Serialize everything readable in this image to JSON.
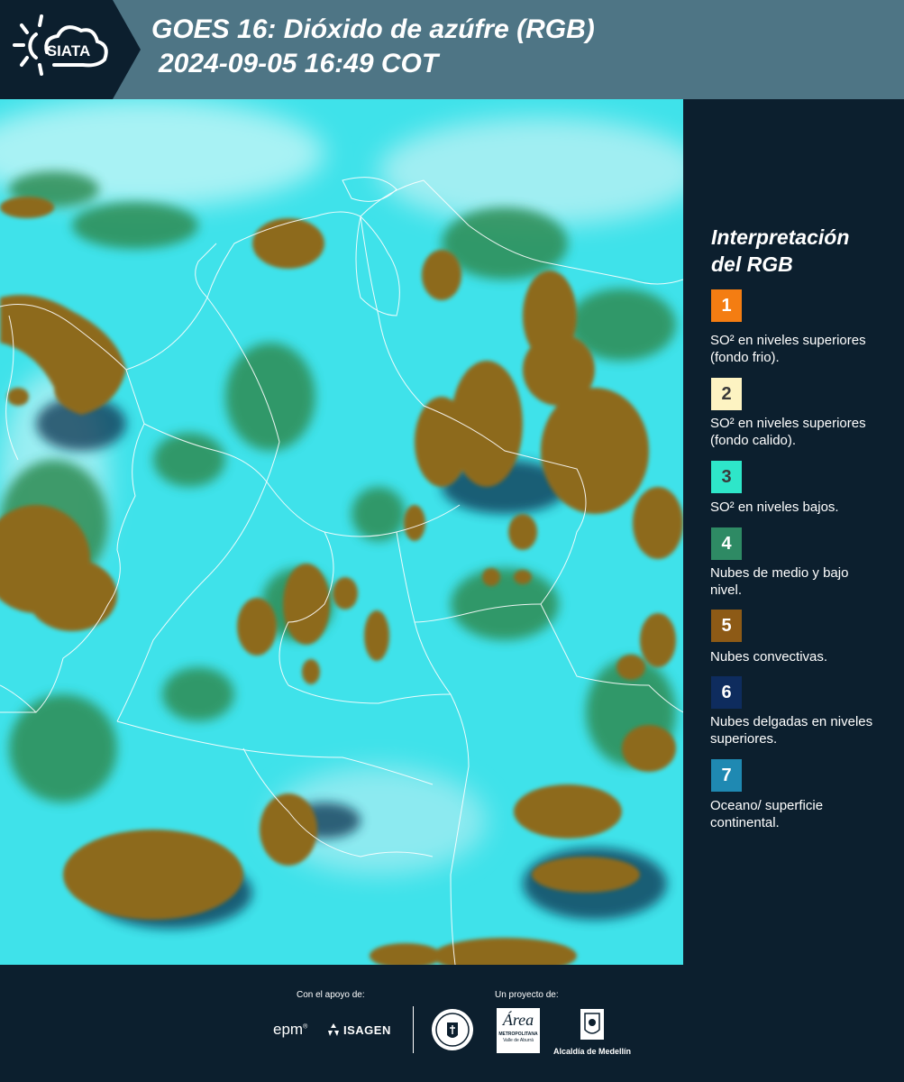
{
  "header": {
    "logo_text": "SIATA",
    "title_line1": "GOES 16: Dióxido de azúfre (RGB)",
    "title_line2": "2024-09-05 16:49 COT"
  },
  "legend": {
    "title_line1": "Interpretación",
    "title_line2": "del RGB",
    "items": [
      {
        "num": "1",
        "color": "#f47d12",
        "text": "SO² en niveles superiores (fondo frio)."
      },
      {
        "num": "2",
        "color": "#fdf3c2",
        "text": "SO² en niveles superiores (fondo calido)."
      },
      {
        "num": "3",
        "color": "#2ee6c9",
        "text": "SO² en niveles bajos."
      },
      {
        "num": "4",
        "color": "#2e8a64",
        "text": "Nubes de medio y bajo nivel."
      },
      {
        "num": "5",
        "color": "#8d5a16",
        "text": "Nubes convectivas."
      },
      {
        "num": "6",
        "color": "#0e2c5e",
        "text": "Nubes delgadas en niveles superiores."
      },
      {
        "num": "7",
        "color": "#1f89b2",
        "text": "Oceano/ superficie continental."
      }
    ]
  },
  "footer": {
    "support_label": "Con el apoyo de:",
    "project_label": "Un proyecto de:",
    "sponsor_epm": "epm",
    "sponsor_isagen": "ISAGEN",
    "partner_area_line1": "METROPOLITANA",
    "partner_area_line2": "Valle de Aburrá",
    "partner_alcaldia": "Alcaldía de Medellín"
  },
  "map": {
    "colors": {
      "land": "#3fe2ea",
      "convective": "#8d6a1e",
      "midlow": "#2f8c52",
      "thin": "#0e3250",
      "borders": "#ffffff"
    }
  }
}
